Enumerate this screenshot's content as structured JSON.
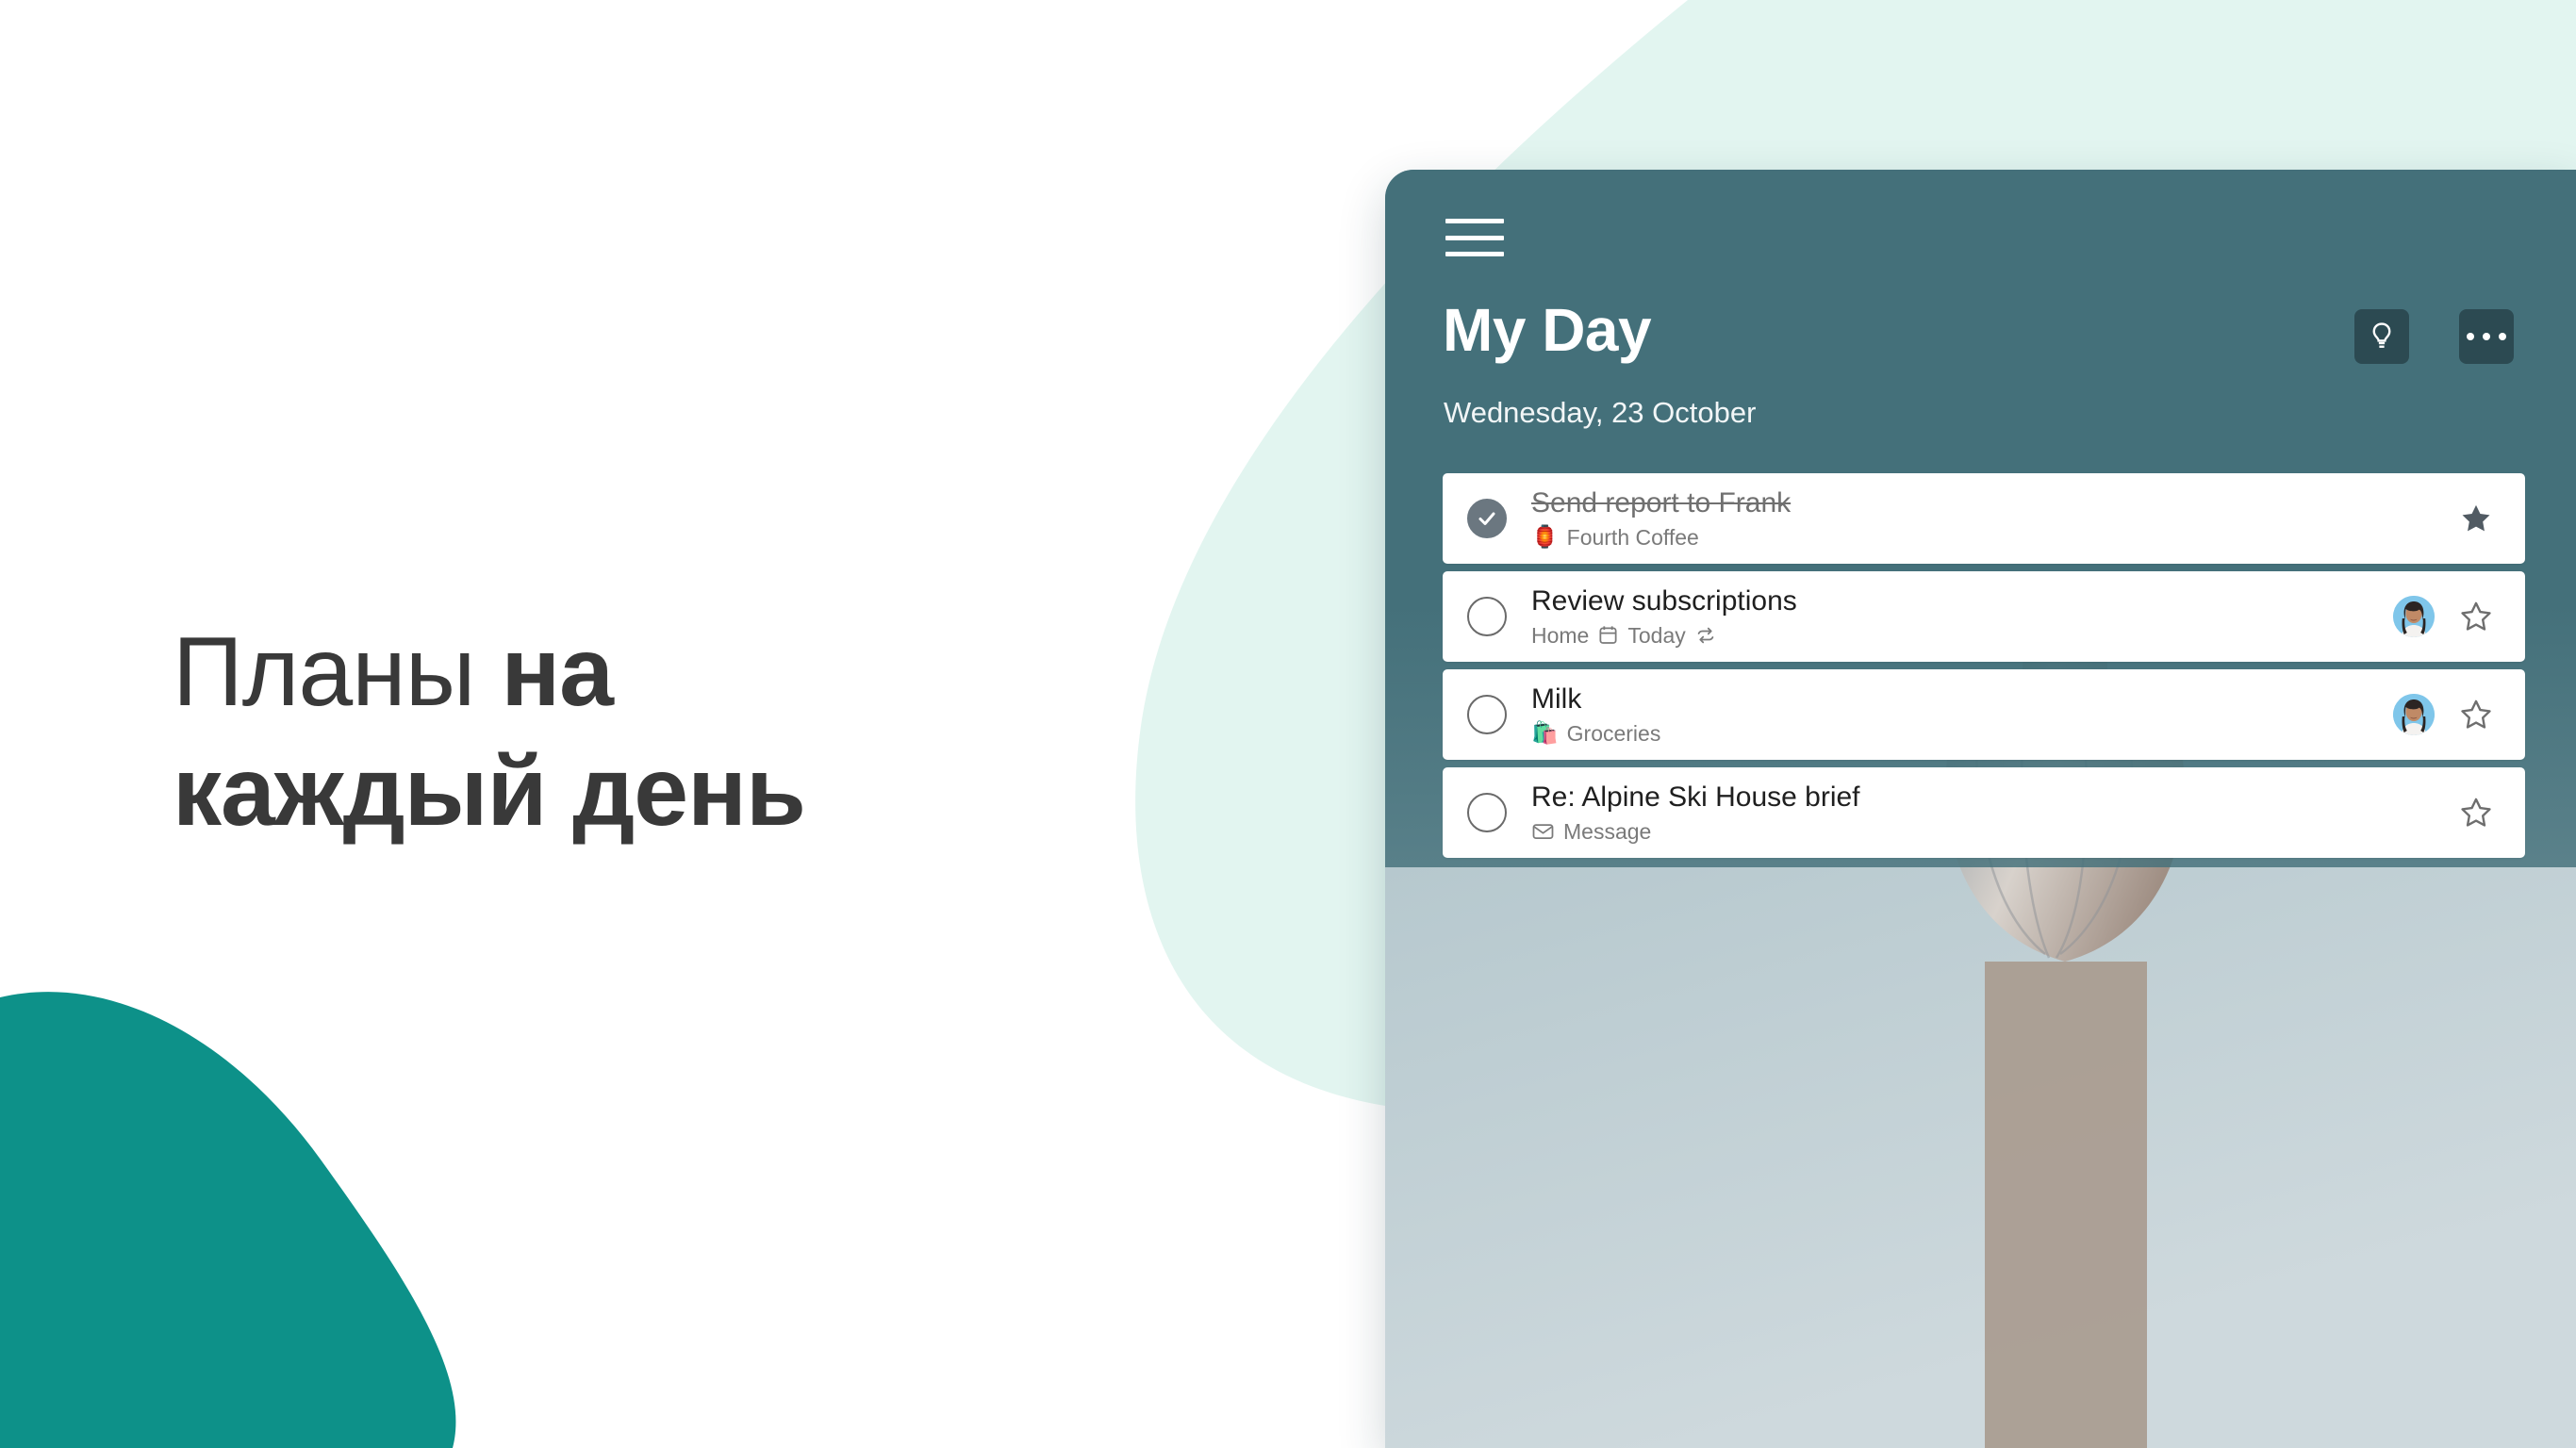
{
  "promo": {
    "headline_light": "Планы ",
    "headline_bold_1": "на",
    "headline_bold_2": "каждый день"
  },
  "colors": {
    "teal_blob": "#0d9189",
    "mint_shape": "#e2f5f0",
    "window_header": "#44707a",
    "header_button": "#2c4a52",
    "done_check_fill": "#6b7780",
    "star_filled": "#515b63",
    "avatar_bg": "#7fc6ea"
  },
  "app": {
    "menu_icon": "hamburger-icon",
    "title": "My Day",
    "subtitle": "Wednesday, 23 October",
    "actions": [
      {
        "name": "lightbulb-icon",
        "label": "Suggestions"
      },
      {
        "name": "more-options-icon",
        "label": "..."
      }
    ],
    "tasks": [
      {
        "title": "Send report to Frank",
        "completed": true,
        "meta_emoji": "🏮",
        "meta_emoji_name": "coffee-cup-emoji",
        "meta_text": "Fourth Coffee",
        "meta_icons": [],
        "has_avatar": false,
        "starred": true
      },
      {
        "title": "Review subscriptions",
        "completed": false,
        "meta_emoji": "",
        "meta_emoji_name": "",
        "meta_text": "Home",
        "meta_icons": [
          "calendar-icon",
          "repeat-icon"
        ],
        "meta_date": "Today",
        "has_avatar": true,
        "starred": false
      },
      {
        "title": "Milk",
        "completed": false,
        "meta_emoji": "🛍️",
        "meta_emoji_name": "shopping-bags-emoji",
        "meta_text": "Groceries",
        "meta_icons": [],
        "has_avatar": true,
        "starred": false
      },
      {
        "title": "Re: Alpine Ski House brief",
        "completed": false,
        "meta_emoji": "",
        "meta_emoji_name": "",
        "meta_text": "Message",
        "meta_icons": [
          "envelope-icon"
        ],
        "has_avatar": false,
        "starred": false
      }
    ]
  }
}
